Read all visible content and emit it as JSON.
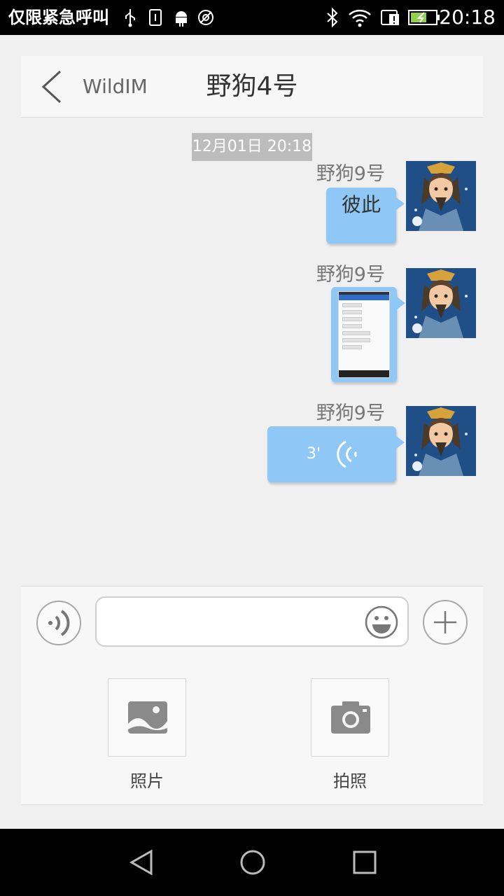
{
  "status_bar": {
    "carrier_text": "仅限紧急呼叫",
    "time": "20:18",
    "icons": [
      "usb-icon",
      "sim-icon",
      "android-debug-icon",
      "sync-off-icon",
      "bluetooth-icon",
      "wifi-icon",
      "sim-alert-icon",
      "battery-charging-icon"
    ]
  },
  "header": {
    "back_icon": "chevron-left-icon",
    "app_name": "WildIM",
    "title": "野狗4号"
  },
  "timestamp": "12月01日 20:18",
  "messages": [
    {
      "sender": "野狗9号",
      "type": "text",
      "text": "彼此",
      "avatar": "warrior-avatar"
    },
    {
      "sender": "野狗9号",
      "type": "image",
      "avatar": "warrior-avatar"
    },
    {
      "sender": "野狗9号",
      "type": "voice",
      "duration": "3'",
      "avatar": "warrior-avatar"
    }
  ],
  "input": {
    "voice_icon": "voice-icon",
    "emoji_icon": "emoji-icon",
    "plus_icon": "plus-icon",
    "value": "",
    "placeholder": ""
  },
  "attachments": [
    {
      "label": "照片",
      "icon": "photo-icon"
    },
    {
      "label": "拍照",
      "icon": "camera-icon"
    }
  ],
  "colors": {
    "bubble": "#8fc8f6",
    "status_bar": "#000000",
    "timestamp_bg": "#bcbcbc"
  }
}
